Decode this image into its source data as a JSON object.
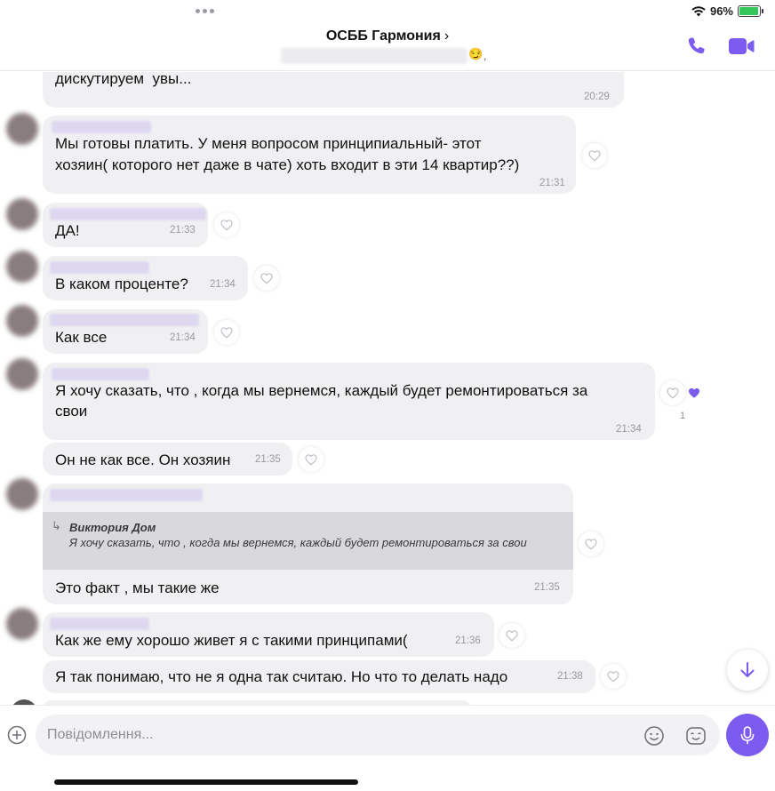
{
  "status_bar": {
    "battery": "96%",
    "battery_level": 0.96
  },
  "header": {
    "title": "ОСББ Гармония",
    "title_chevron": "›",
    "subtitle_emoji": "😏",
    "subtitle_comma": ","
  },
  "messages": [
    {
      "text": "дискутируем  увы...",
      "time": "20:29"
    },
    {
      "text_lines": [
        "Мы готовы платить. У меня вопросом принципиальный- этот",
        "хозяин( которого нет даже в чате) хоть входит в эти 14 квартир??)"
      ],
      "time": "21:31"
    },
    {
      "text": "ДА!",
      "time": "21:33"
    },
    {
      "text": "В каком проценте?",
      "time": "21:34"
    },
    {
      "text": "Как все",
      "time": "21:34"
    },
    {
      "text_lines": [
        "Я хочу сказать, что , когда мы вернемся, каждый будет ремонтироваться за",
        "свои"
      ],
      "time": "21:34",
      "likes": "1"
    },
    {
      "text": "Он не как все. Он хозяин",
      "time": "21:35"
    },
    {
      "quote_author": "Виктория Дом",
      "quote_text": "Я хочу сказать, что , когда мы вернемся, каждый будет ремонтироваться за свои",
      "quote_arrow": "↳",
      "text": "Это факт , мы такие же",
      "time": "21:35"
    },
    {
      "text": "Как же ему хорошо живет я с такими принципами(",
      "time": "21:36"
    },
    {
      "text": "Я так понимаю, что не я одна так считаю. Но что то делать надо",
      "time": "21:38"
    }
  ],
  "input": {
    "placeholder": "Повідомлення..."
  },
  "colors": {
    "accent": "#7c5cf0",
    "bubble": "#f0f0f2",
    "quote_bg": "#d9d9dd",
    "battery": "#34c759"
  },
  "icons": [
    "call-icon",
    "video-icon",
    "heart-icon",
    "arrow-down-icon",
    "plus-icon",
    "emoji-icon",
    "sticker-icon",
    "mic-icon"
  ]
}
